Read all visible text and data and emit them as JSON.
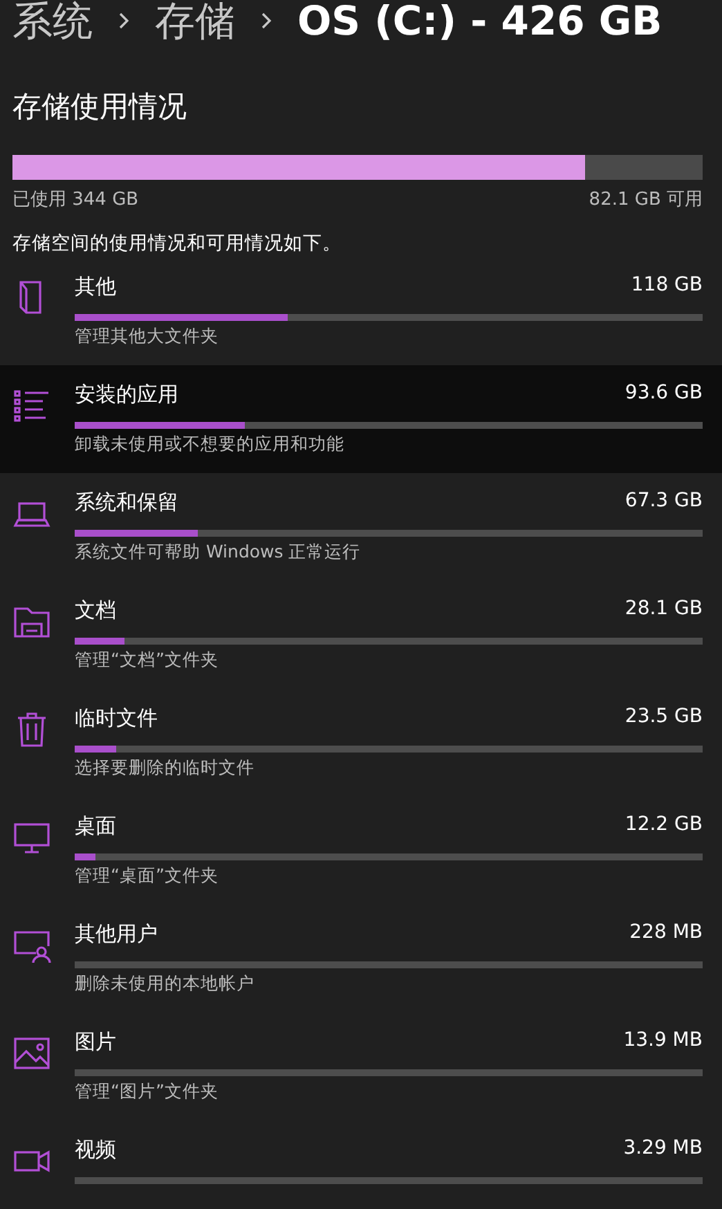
{
  "breadcrumb": [
    "系统",
    "存储",
    "OS (C:) - 426 GB"
  ],
  "section_title": "存储使用情况",
  "usage": {
    "level": 0.83,
    "used": "已使用 344 GB",
    "free": "82.1 GB 可用"
  },
  "description": "存储空间的使用情况和可用情况如下。",
  "categories": [
    {
      "name": "其他",
      "size": "118 GB",
      "level": 0.34,
      "subtitle": "管理其他大文件夹",
      "highlighted": false
    },
    {
      "name": "安装的应用",
      "size": "93.6 GB",
      "level": 0.27,
      "subtitle": "卸载未使用或不想要的应用和功能",
      "highlighted": true
    },
    {
      "name": "系统和保留",
      "size": "67.3 GB",
      "level": 0.195,
      "subtitle": "系统文件可帮助 Windows 正常运行",
      "highlighted": false
    },
    {
      "name": "文档",
      "size": "28.1 GB",
      "level": 0.08,
      "subtitle": "管理“文档”文件夹",
      "highlighted": false
    },
    {
      "name": "临时文件",
      "size": "23.5 GB",
      "level": 0.066,
      "subtitle": "选择要删除的临时文件",
      "highlighted": false
    },
    {
      "name": "桌面",
      "size": "12.2 GB",
      "level": 0.033,
      "subtitle": "管理“桌面”文件夹",
      "highlighted": false
    },
    {
      "name": "其他用户",
      "size": "228 MB",
      "level": 0,
      "subtitle": "删除未使用的本地帐户",
      "highlighted": false
    },
    {
      "name": "图片",
      "size": "13.9 MB",
      "level": 0,
      "subtitle": "管理“图片”文件夹",
      "highlighted": false
    },
    {
      "name": "视频",
      "size": "3.29 MB",
      "level": 0
    }
  ]
}
